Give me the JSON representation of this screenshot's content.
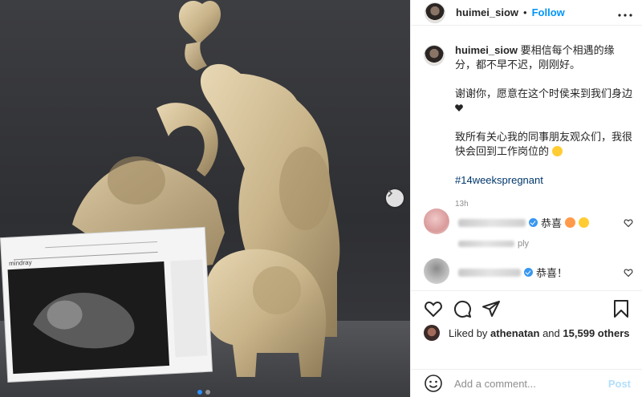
{
  "post": {
    "author": "huimei_siow",
    "header_separator": "•",
    "follow_label": "Follow",
    "more_label": "•••",
    "image_count": 2,
    "current_image": 1,
    "ultrasound_brand": "mindray"
  },
  "caption": {
    "author": "huimei_siow",
    "line1": "要相信每个相遇的缘分，都不早不迟，刚刚好。",
    "line2": "谢谢你，愿意在这个时侯来到我们身边",
    "line3": "致所有关心我的同事朋友观众们，我很快会回到工作岗位的",
    "hashtag": "#14weekspregnant",
    "time": "13h"
  },
  "comments": [
    {
      "text": "恭喜",
      "reply_label": "ply",
      "verified": true
    },
    {
      "text": "恭喜！",
      "verified": true
    }
  ],
  "likes": {
    "prefix": "Liked by",
    "user": "athenatan",
    "and": "and",
    "count": "15,599 others"
  },
  "input": {
    "placeholder": "Add a comment...",
    "post_label": "Post"
  },
  "colors": {
    "accent": "#0095f6",
    "post_disabled": "#b2dffc",
    "hashtag": "#00376b",
    "muted": "#8e8e8e"
  },
  "icons": [
    "heart-icon",
    "comment-icon",
    "share-icon",
    "bookmark-icon",
    "smiley-icon",
    "more-icon",
    "next-arrow-icon",
    "verified-icon"
  ]
}
